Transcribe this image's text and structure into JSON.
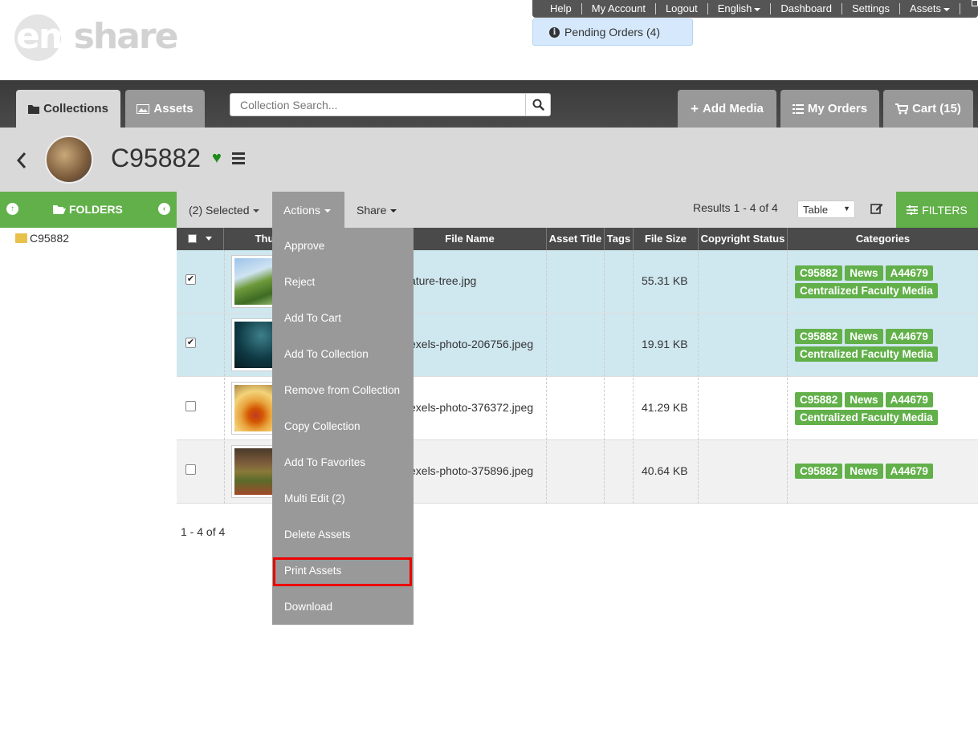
{
  "top_nav": {
    "items": [
      "Help",
      "My Account",
      "Logout",
      "English",
      "Dashboard",
      "Settings",
      "Assets"
    ]
  },
  "pending_orders": "Pending Orders (4)",
  "logo_text": "emshare",
  "tabs": {
    "collections": "Collections",
    "assets": "Assets"
  },
  "search": {
    "placeholder": "Collection Search..."
  },
  "right_buttons": {
    "add_media": "Add Media",
    "my_orders": "My Orders",
    "cart": "Cart (15)"
  },
  "collection": {
    "title": "C95882"
  },
  "folders": {
    "label": "FOLDERS",
    "tree": [
      "C95882"
    ]
  },
  "toolbar": {
    "selected": "(2) Selected",
    "actions": "Actions",
    "share": "Share",
    "results": "Results 1 - 4 of 4",
    "view": "Table",
    "filters": "FILTERS"
  },
  "table": {
    "columns": [
      "Thu",
      "File Name",
      "Asset Title",
      "Tags",
      "File Size",
      "Copyright Status",
      "Categories"
    ],
    "rows": [
      {
        "checked": true,
        "file": "ature-tree.jpg",
        "size": "55.31 KB",
        "categories": [
          "C95882",
          "News",
          "A44679",
          "Centralized Faculty Media"
        ]
      },
      {
        "checked": true,
        "file": "exels-photo-206756.jpeg",
        "size": "19.91 KB",
        "categories": [
          "C95882",
          "News",
          "A44679",
          "Centralized Faculty Media"
        ]
      },
      {
        "checked": false,
        "file": "exels-photo-376372.jpeg",
        "size": "41.29 KB",
        "categories": [
          "C95882",
          "News",
          "A44679",
          "Centralized Faculty Media"
        ]
      },
      {
        "checked": false,
        "file": "exels-photo-375896.jpeg",
        "size": "40.64 KB",
        "categories": [
          "C95882",
          "News",
          "A44679"
        ]
      }
    ]
  },
  "pager": "1 - 4 of 4",
  "actions_menu": [
    "Approve",
    "Reject",
    "Add To Cart",
    "Add To Collection",
    "Remove from Collection",
    "Copy Collection",
    "Add To Favorites",
    "Multi Edit (2)",
    "Delete Assets",
    "Print Assets",
    "Download"
  ],
  "colors": {
    "green": "#62b04a",
    "selected_row": "#cfe7ef",
    "highlight": "#e00000",
    "dark": "#4a4a4a"
  }
}
